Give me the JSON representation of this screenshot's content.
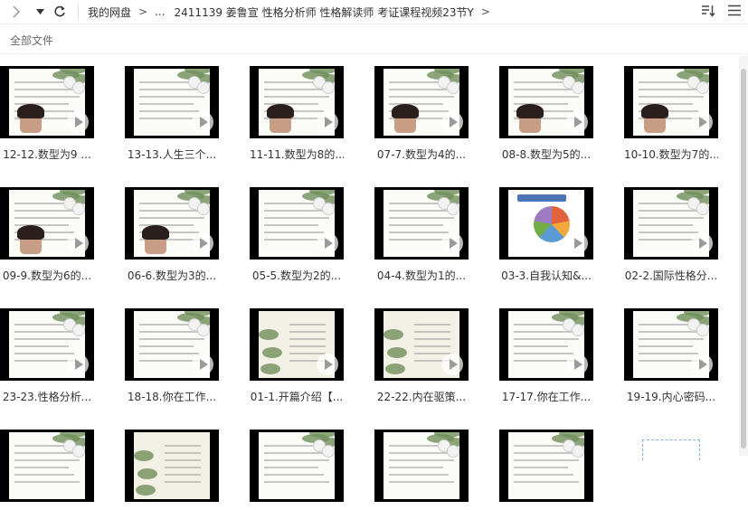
{
  "toolbar": {
    "nav_icons": [
      "chevron-right-icon",
      "chevron-down-icon",
      "refresh-icon"
    ],
    "breadcrumb": {
      "root": "我的网盘",
      "ellipsis": "...",
      "current": "2411139 姜鲁宣 性格分析师 性格解读师 考证课程视频23节Y"
    },
    "right_icons": [
      "sort-icon",
      "list-view-icon"
    ]
  },
  "subheader": {
    "label": "全部文件"
  },
  "files": [
    {
      "name": "12-12.数型为9 ...",
      "style": "teacher"
    },
    {
      "name": "13-13.人生三个...",
      "style": "flower"
    },
    {
      "name": "11-11.数型为8的...",
      "style": "teacher"
    },
    {
      "name": "07-7.数型为4的...",
      "style": "teacher"
    },
    {
      "name": "08-8.数型为5的...",
      "style": "teacher"
    },
    {
      "name": "10-10.数型为7的...",
      "style": "teacher"
    },
    {
      "name": "09-9.数型为6的...",
      "style": "teacher"
    },
    {
      "name": "06-6.数型为3的...",
      "style": "teacher"
    },
    {
      "name": "05-5.数型为2的...",
      "style": "text"
    },
    {
      "name": "04-4.数型为1的...",
      "style": "text"
    },
    {
      "name": "03-3.自我认知&...",
      "style": "pie"
    },
    {
      "name": "02-2.国际性格分...",
      "style": "text"
    },
    {
      "name": "23-23.性格分析...",
      "style": "text"
    },
    {
      "name": "18-18.你在工作...",
      "style": "text"
    },
    {
      "name": "01-1.开篇介绍【...",
      "style": "leaves"
    },
    {
      "name": "22-22.内在驱策...",
      "style": "leaves"
    },
    {
      "name": "17-17.你在工作...",
      "style": "text"
    },
    {
      "name": "19-19.内心密码...",
      "style": "text"
    },
    {
      "name": "",
      "style": "text"
    },
    {
      "name": "",
      "style": "leaves"
    },
    {
      "name": "",
      "style": "flower"
    },
    {
      "name": "",
      "style": "text"
    },
    {
      "name": "",
      "style": "flower"
    }
  ]
}
